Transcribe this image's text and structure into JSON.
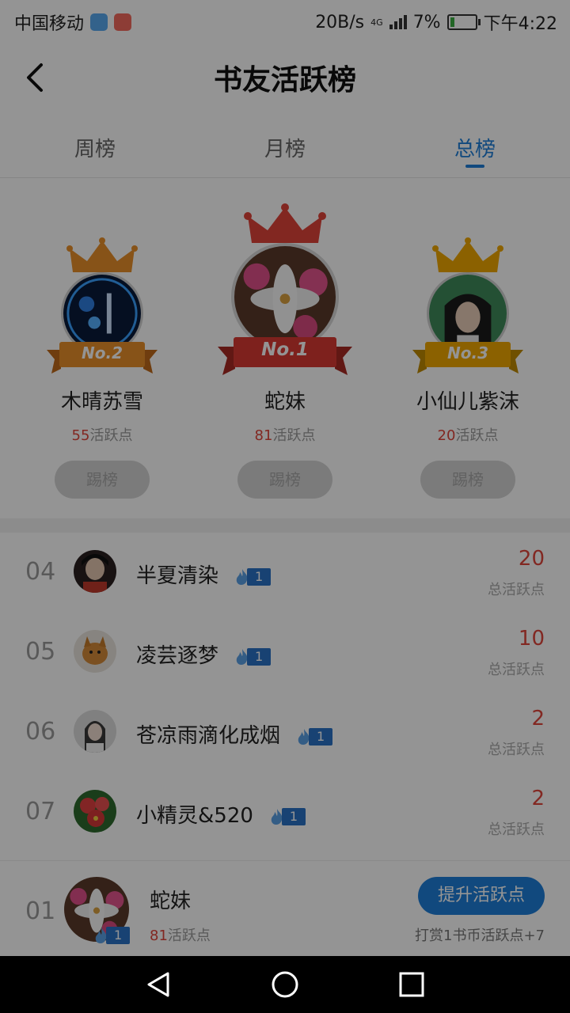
{
  "status_bar": {
    "carrier": "中国移动",
    "speed": "20B/s",
    "network": "4G",
    "battery": "7%",
    "time": "下午4:22"
  },
  "header": {
    "title": "书友活跃榜"
  },
  "tabs": [
    {
      "label": "周榜",
      "active": false
    },
    {
      "label": "月榜",
      "active": false
    },
    {
      "label": "总榜",
      "active": true
    }
  ],
  "podium": [
    {
      "rank_label": "No.2",
      "name": "木晴苏雪",
      "points": "55",
      "points_suffix": "活跃点",
      "action": "踢榜"
    },
    {
      "rank_label": "No.1",
      "name": "蛇妹",
      "points": "81",
      "points_suffix": "活跃点",
      "action": "踢榜"
    },
    {
      "rank_label": "No.3",
      "name": "小仙儿紫沫",
      "points": "20",
      "points_suffix": "活跃点",
      "action": "踢榜"
    }
  ],
  "list": [
    {
      "rank": "04",
      "name": "半夏清染",
      "level": "1",
      "score": "20",
      "score_label": "总活跃点"
    },
    {
      "rank": "05",
      "name": "凌芸逐梦",
      "level": "1",
      "score": "10",
      "score_label": "总活跃点"
    },
    {
      "rank": "06",
      "name": "苍凉雨滴化成烟",
      "level": "1",
      "score": "2",
      "score_label": "总活跃点"
    },
    {
      "rank": "07",
      "name": "小精灵&520",
      "level": "1",
      "score": "2",
      "score_label": "总活跃点"
    }
  ],
  "my_rank": {
    "rank": "01",
    "name": "蛇妹",
    "level": "1",
    "points": "81",
    "points_suffix": "活跃点",
    "button": "提升活跃点",
    "hint": "打赏1书币活跃点+7"
  },
  "colors": {
    "accent": "#1e7fd9",
    "points_red": "#e0453b",
    "gold": "#f0a800",
    "crown_red": "#e0443a",
    "silver_orange": "#e8902a"
  }
}
